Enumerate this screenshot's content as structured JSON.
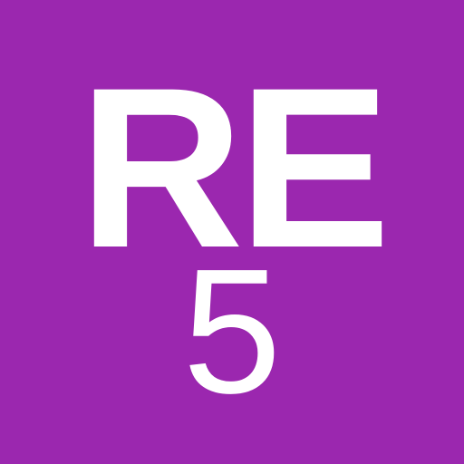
{
  "tile": {
    "background_color": "#9b27af",
    "text_color": "#ffffff",
    "letters": "RE",
    "number": "5"
  }
}
